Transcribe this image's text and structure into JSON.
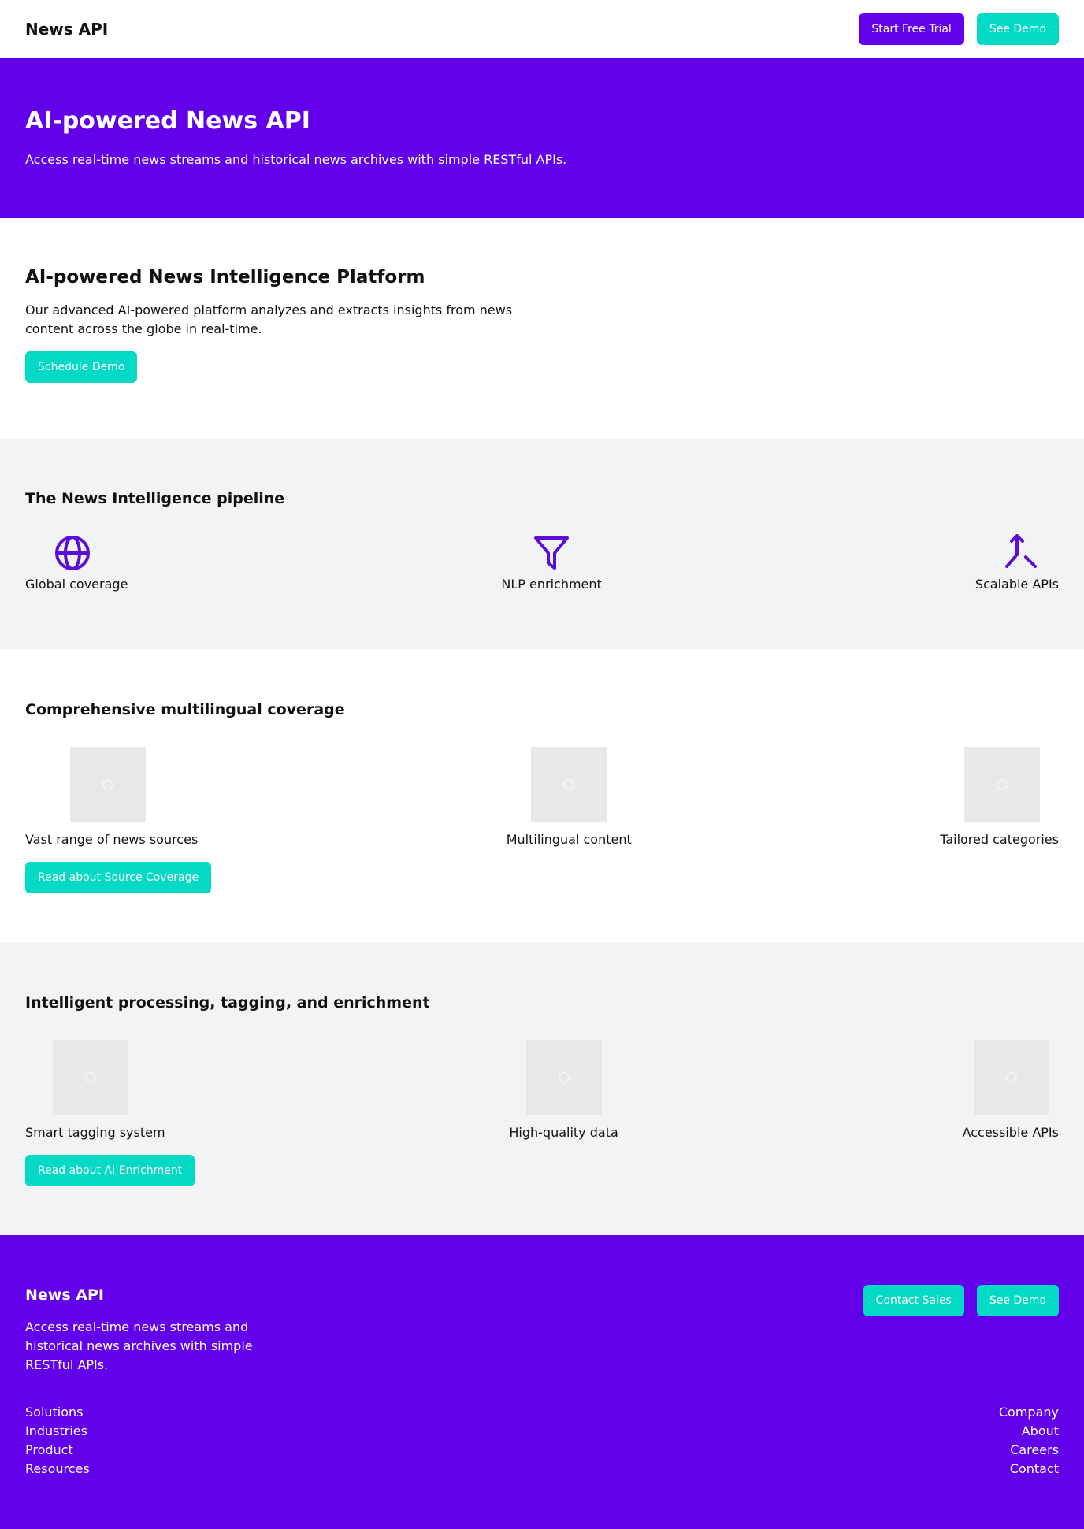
{
  "header": {
    "brand": "News API",
    "start_trial_label": "Start Free Trial",
    "see_demo_label": "See Demo"
  },
  "hero": {
    "title": "AI-powered News API",
    "subtitle": "Access real-time news streams and historical news archives with simple RESTful APIs."
  },
  "platform": {
    "title": "AI-powered News Intelligence Platform",
    "description": "Our advanced AI-powered platform analyzes and extracts insights from news content across the globe in real-time.",
    "button_label": "Schedule Demo"
  },
  "pipeline": {
    "title": "The News Intelligence pipeline",
    "items": [
      {
        "label": "Global coverage",
        "icon": "globe-icon"
      },
      {
        "label": "NLP enrichment",
        "icon": "filter-icon"
      },
      {
        "label": "Scalable APIs",
        "icon": "merge-icon"
      }
    ]
  },
  "coverage": {
    "title": "Comprehensive multilingual coverage",
    "items": [
      {
        "label": "Vast range of news sources"
      },
      {
        "label": "Multilingual content"
      },
      {
        "label": "Tailored categories"
      }
    ],
    "button_label": "Read about Source Coverage"
  },
  "enrichment": {
    "title": "Intelligent processing, tagging, and enrichment",
    "items": [
      {
        "label": "Smart tagging system"
      },
      {
        "label": "High-quality data"
      },
      {
        "label": "Accessible APIs"
      }
    ],
    "button_label": "Read about AI Enrichment"
  },
  "footer": {
    "brand": "News API",
    "description": "Access real-time news streams and historical news archives with simple RESTful APIs.",
    "contact_sales_label": "Contact Sales",
    "see_demo_label": "See Demo",
    "left_links": [
      "Solutions",
      "Industries",
      "Product",
      "Resources"
    ],
    "right_links": [
      "Company",
      "About",
      "Careers",
      "Contact"
    ]
  },
  "colors": {
    "primary": "#6200ea",
    "accent": "#03dac6",
    "section_bg": "#f2f3f5",
    "icon": "#5a0ed6"
  }
}
